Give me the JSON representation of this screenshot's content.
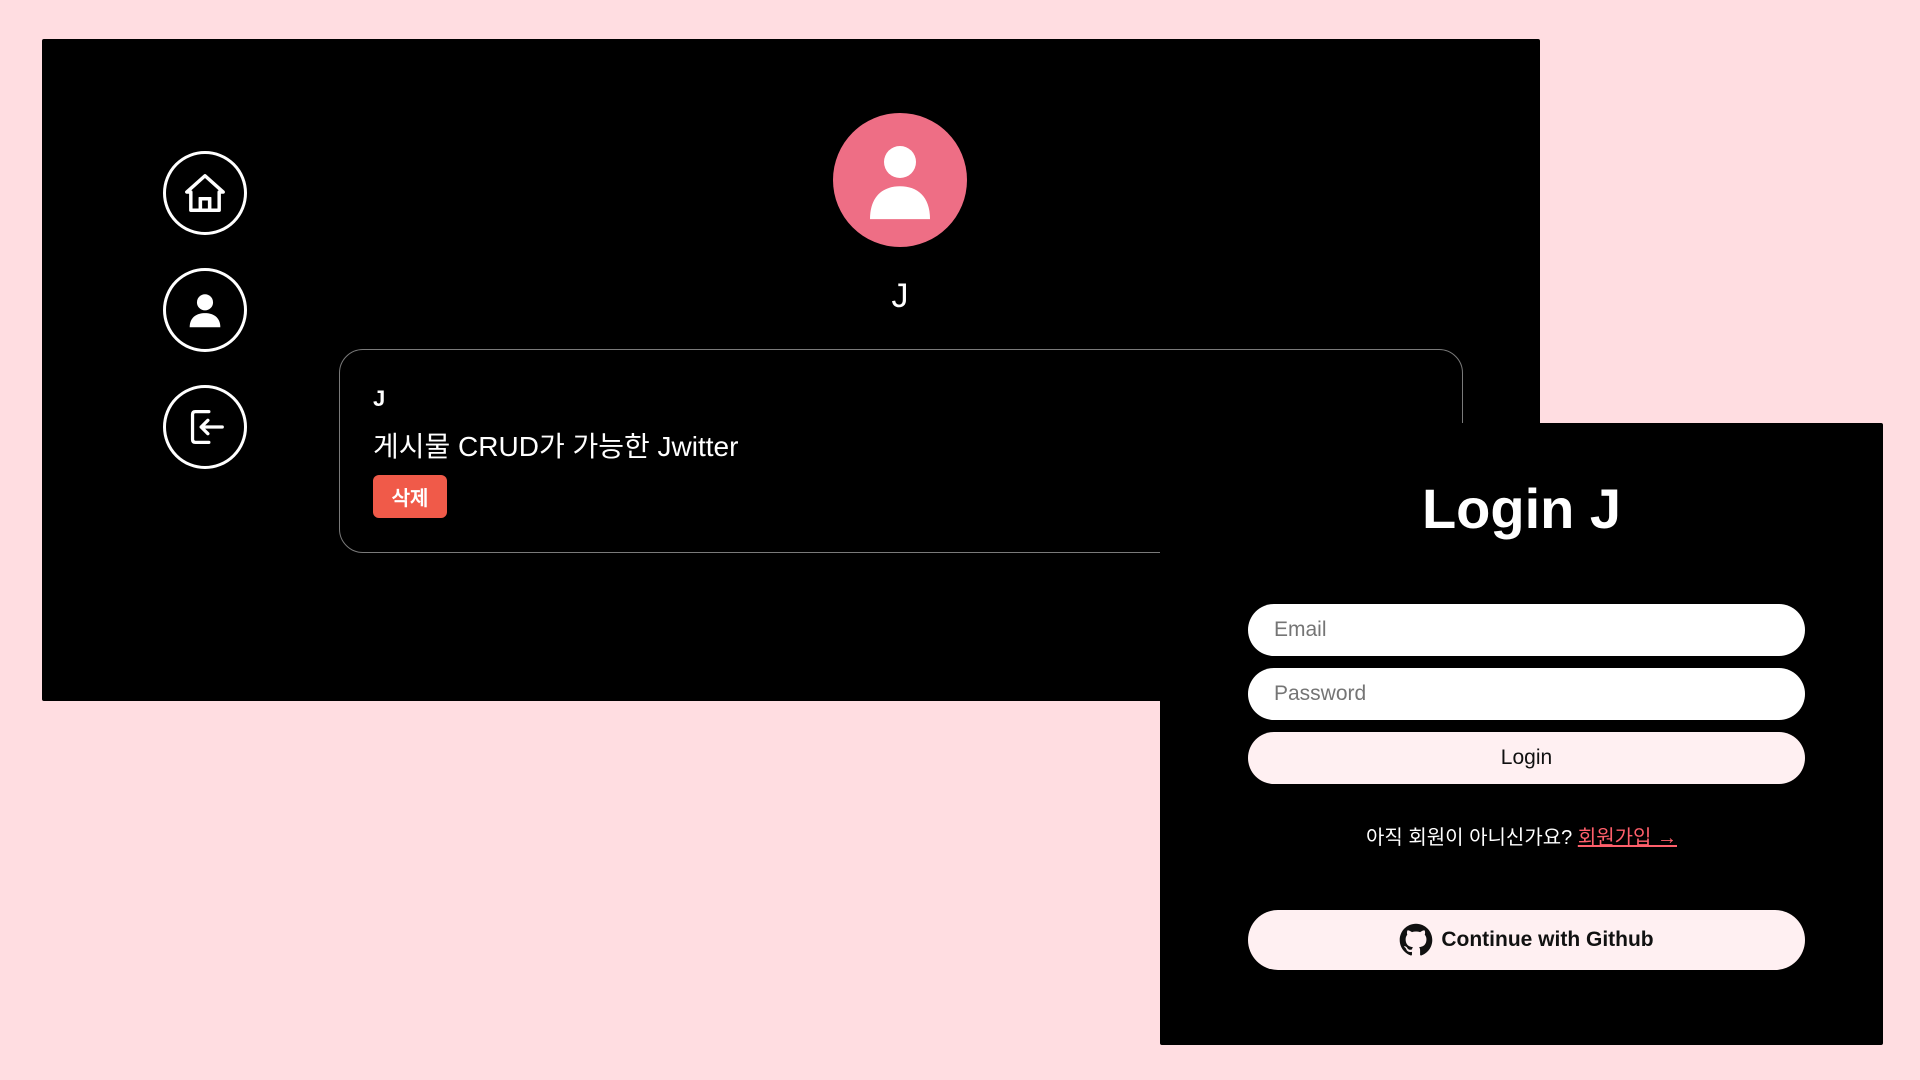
{
  "colors": {
    "page_background": "#ffdde1",
    "panel_background": "#000000",
    "avatar_background": "#ee6e85",
    "delete_button": "#f05a49",
    "signup_link": "#ff5f6b",
    "button_light": "#fff0f2"
  },
  "sidebar": {
    "items": [
      {
        "icon": "home-icon"
      },
      {
        "icon": "user-icon"
      },
      {
        "icon": "logout-icon"
      }
    ]
  },
  "profile": {
    "avatar_icon": "user-icon",
    "name": "J"
  },
  "tweet": {
    "username": "J",
    "text": "게시물 CRUD가 가능한 Jwitter",
    "delete_label": "삭제"
  },
  "login": {
    "title": "Login J",
    "email_placeholder": "Email",
    "password_placeholder": "Password",
    "login_label": "Login",
    "signup_prompt": "아직 회원이 아니신가요?",
    "signup_link": "회원가입 →",
    "github_icon": "github-icon",
    "github_label": "Continue with Github"
  }
}
